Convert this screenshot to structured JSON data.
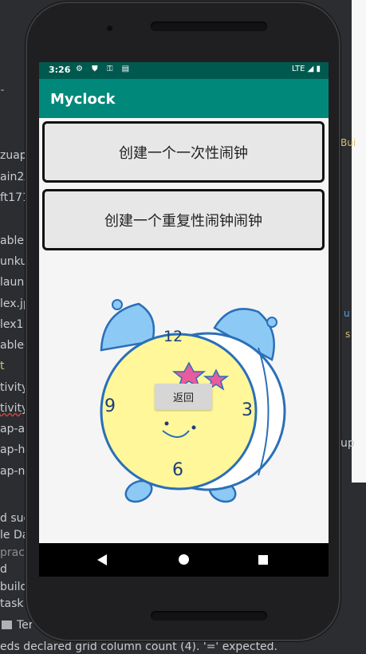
{
  "ide": {
    "left_fragments": [
      "zuap",
      "ain2A",
      "ft171",
      "able",
      "unkua",
      "launc",
      "lex.jp",
      "lex1.",
      "able-",
      "t",
      "tivity",
      "tivity",
      "ap-a",
      "ap-h",
      "ap-n",
      "d suc",
      "le Da",
      "pract",
      "d",
      "build",
      "task",
      "Ter"
    ],
    "right_fragments": [
      "Bui",
      "u",
      "s",
      "up"
    ],
    "console_line": "eds declared grid column count (4). '=' expected."
  },
  "status_bar": {
    "time": "3:26",
    "icons": "⚙ ⛊ ⚿ ▤",
    "right": "LTE ◢ ▮"
  },
  "app": {
    "title": "Myclock"
  },
  "buttons": {
    "one_time_alarm": "创建一个一次性闹钟",
    "repeating_alarm": "创建一个重复性闹钟闹钟",
    "return": "返回"
  },
  "clock": {
    "numbers": [
      "12",
      "3",
      "6",
      "9"
    ]
  },
  "colors": {
    "app_bar": "#00897b",
    "status_bar": "#00594f",
    "clock_face": "#fff79a",
    "clock_bells": "#8ccaf5"
  }
}
